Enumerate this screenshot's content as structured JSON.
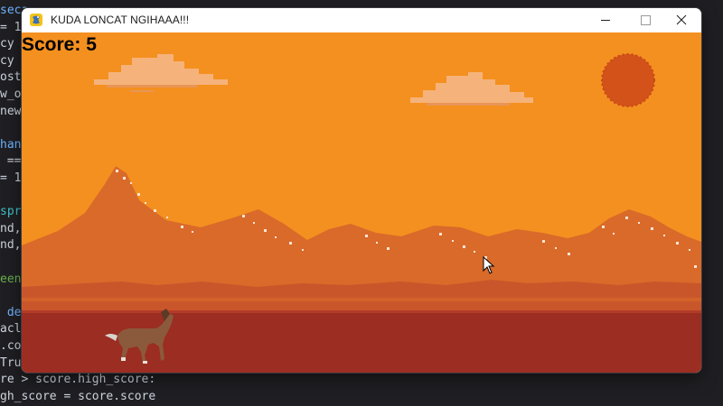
{
  "editor": {
    "lines": [
      "seca",
      "= 1",
      "cy =",
      "cy =",
      "osta",
      "w_ob",
      "new_",
      "",
      "han",
      " ==",
      "= 1",
      "",
      "spri",
      "nd,",
      "nd,",
      "",
      "een)",
      "",
      " der",
      "acle",
      ".col",
      "True",
      "re > score.high_score:",
      "gh_score = score.score"
    ]
  },
  "window": {
    "title": "KUDA LONCAT NGIHAAA!!!",
    "icon": "pygame-snake-icon",
    "controls": [
      "minimize-icon",
      "maximize-icon",
      "close-icon"
    ]
  },
  "game": {
    "score_text": "Score: 5",
    "score": 5,
    "player": "horse-sprite",
    "colors": {
      "sky": "#f4901f",
      "cloud": "#f5b37b",
      "sun": "#d2521a",
      "mountain_far": "#d96a2a",
      "mountain_mid": "#c9562a",
      "ground": "#9b2d22"
    }
  }
}
